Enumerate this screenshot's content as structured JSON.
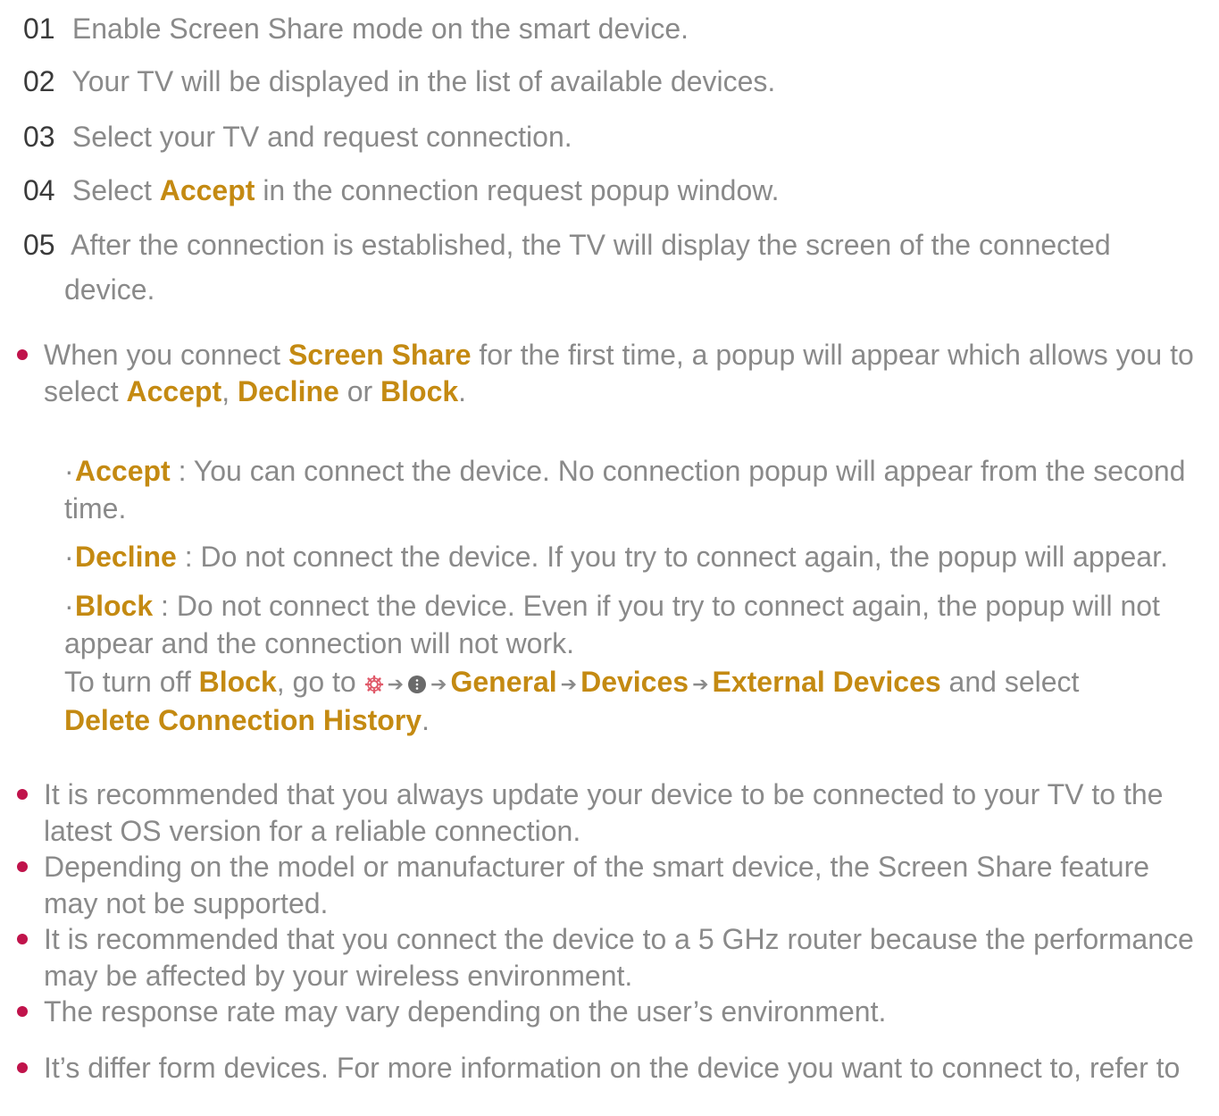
{
  "steps": [
    {
      "num": "01",
      "text": "Enable Screen Share mode on the smart device."
    },
    {
      "num": "02",
      "text": "Your TV will be displayed in the list of available devices."
    },
    {
      "num": "03",
      "text": "Select your TV and request connection."
    },
    {
      "num": "04",
      "pre": "Select ",
      "hl": "Accept",
      "post": " in the connection request popup window."
    },
    {
      "num": "05",
      "text": "After the connection is established, the TV will display the screen of the connected",
      "cont": "device."
    }
  ],
  "note1": {
    "pre": "When you connect ",
    "hl1": "Screen Share",
    "mid": " for the first time, a popup will appear which allows you to",
    "l2_pre": "select ",
    "hl_accept": "Accept",
    "comma": ", ",
    "hl_decline": "Decline",
    "or": " or ",
    "hl_block": "Block",
    "end": "."
  },
  "subs": {
    "accept": {
      "hl": "Accept",
      "text": " : You can connect the device. No connection popup will appear from the second",
      "cont": "time."
    },
    "decline": {
      "hl": "Decline",
      "text": " : Do not connect the device. If you try to connect again, the popup will appear."
    },
    "block": {
      "hl": "Block",
      "text": " : Do not connect the device. Even if you try to connect again, the popup will not",
      "cont": "appear and the connection will not work."
    },
    "turnoff": {
      "pre": "To turn off ",
      "hl_block": "Block",
      "goto": ", go to ",
      "general": "General",
      "devices": "Devices",
      "external": "External Devices",
      "and_select": " and select",
      "delete": "Delete Connection History",
      "end": "."
    }
  },
  "notes": [
    {
      "l1": "It is recommended that you always update your device to be connected to your TV to the",
      "l2": "latest OS version for a reliable connection."
    },
    {
      "l1": "Depending on the model or manufacturer of the smart device, the Screen Share feature",
      "l2": "may not be supported."
    },
    {
      "l1": "It is recommended that you connect the device to a 5 GHz router because the performance",
      "l2": "may be affected by your wireless environment."
    },
    {
      "l1": "The response rate may vary depending on the user’s environment."
    },
    {
      "l1": "It’s differ form devices. For more information on the device you want to connect to, refer to"
    }
  ],
  "icons": {
    "settings": "gear-icon",
    "more": "more-options-icon",
    "arrow": "arrow-right-icon"
  },
  "colors": {
    "highlight": "#c48a12",
    "bullet": "#c0134b",
    "text": "#8a8a8a",
    "number": "#3a3a3a"
  }
}
